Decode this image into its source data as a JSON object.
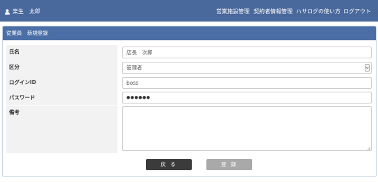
{
  "header": {
    "user_name": "楽生　太郎",
    "nav": [
      "営業施設管理",
      "契約者情報管理",
      "ハサログの使い方",
      "ログアウト"
    ]
  },
  "panel": {
    "title": "従業員　新規登録",
    "fields": {
      "name": {
        "label": "氏名",
        "value": "店長　次郎"
      },
      "category": {
        "label": "区分",
        "value": "管理者"
      },
      "login_id": {
        "label": "ログインID",
        "value": "boss"
      },
      "password": {
        "label": "パスワード",
        "value": "●●●●●●"
      },
      "notes": {
        "label": "備考",
        "value": ""
      }
    },
    "buttons": {
      "back": "戻 る",
      "register": "登 録"
    }
  },
  "colors": {
    "header_bg": "#49689c",
    "panel_header_bg": "#4a6ea5",
    "label_bg": "#f2f2f2",
    "back_button": "#3b3b3b",
    "register_button_disabled": "#a9a9a9"
  },
  "icons": {
    "user": "user-icon",
    "select": "chevron-down-icon",
    "resize": "resize-grip-icon"
  }
}
